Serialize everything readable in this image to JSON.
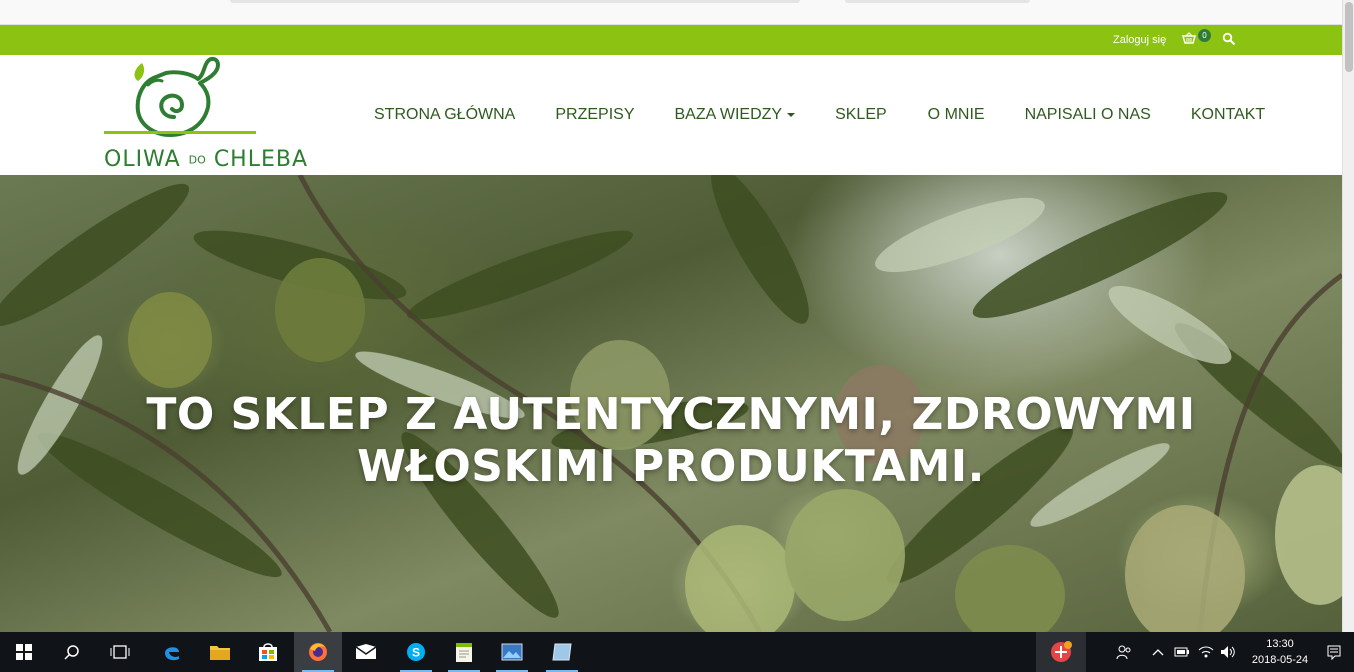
{
  "topbar": {
    "login_label": "Zaloguj się",
    "cart_count": "0",
    "bar_color": "#8cc313"
  },
  "logo": {
    "word1": "OLIWA",
    "word2": "DO",
    "word3": "CHLEBA",
    "brand_color": "#2e7d32"
  },
  "nav": {
    "items": [
      {
        "label": "STRONA GŁÓWNA"
      },
      {
        "label": "PRZEPISY"
      },
      {
        "label": "BAZA WIEDZY",
        "has_dropdown": true
      },
      {
        "label": "SKLEP"
      },
      {
        "label": "O MNIE"
      },
      {
        "label": "NAPISALI O NAS"
      },
      {
        "label": "KONTAKT"
      }
    ],
    "text_color": "#2f5a1f"
  },
  "hero": {
    "title_line1": "TO SKLEP Z AUTENTYCZNYMI, ZDROWYMI",
    "title_line2": "WŁOSKIMI PRODUKTAMI."
  },
  "taskbar": {
    "icons": [
      "windows-start-icon",
      "search-icon",
      "task-view-icon",
      "edge-icon",
      "file-explorer-icon",
      "store-icon",
      "firefox-icon",
      "mail-icon",
      "skype-icon",
      "notepad-icon",
      "photos-icon",
      "app-icon"
    ],
    "clock_time": "13:30",
    "clock_date": "2018-05-24"
  }
}
